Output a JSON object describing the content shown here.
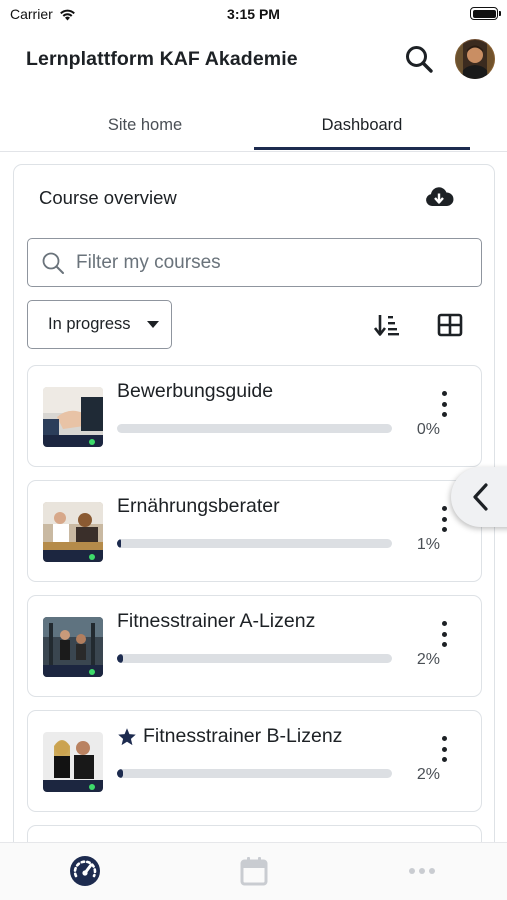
{
  "status_bar": {
    "carrier": "Carrier",
    "time": "3:15 PM"
  },
  "header": {
    "title": "Lernplattform KAF Akademie",
    "search_icon": "search-icon",
    "avatar_icon": "user-avatar"
  },
  "tabs": [
    {
      "label": "Site home",
      "active": false
    },
    {
      "label": "Dashboard",
      "active": true
    }
  ],
  "course_overview": {
    "title": "Course overview",
    "download_icon": "cloud-download-icon",
    "filter": {
      "placeholder": "Filter my courses",
      "value": ""
    },
    "grouping": {
      "selected": "In progress"
    },
    "sort_icon": "sort-icon",
    "view_icon": "grid-view-icon",
    "courses": [
      {
        "name": "Bewerbungsguide",
        "progress": 0,
        "progress_label": "0%",
        "starred": false
      },
      {
        "name": "Ernährungsberater",
        "progress": 1,
        "progress_label": "1%",
        "starred": false
      },
      {
        "name": "Fitnesstrainer A-Lizenz",
        "progress": 2,
        "progress_label": "2%",
        "starred": false
      },
      {
        "name": "Fitnesstrainer B-Lizenz",
        "progress": 2,
        "progress_label": "2%",
        "starred": true
      }
    ]
  },
  "drawer": {
    "icon": "chevron-left-icon"
  },
  "bottom_bar": [
    {
      "icon": "dashboard-gauge-icon",
      "active": true
    },
    {
      "icon": "calendar-icon",
      "active": false
    },
    {
      "icon": "more-icon",
      "active": false
    }
  ],
  "colors": {
    "accent": "#1d2b4f",
    "track": "#dcdfe3",
    "border": "#dee2e6",
    "inactive_icon": "#c9ccd1"
  }
}
